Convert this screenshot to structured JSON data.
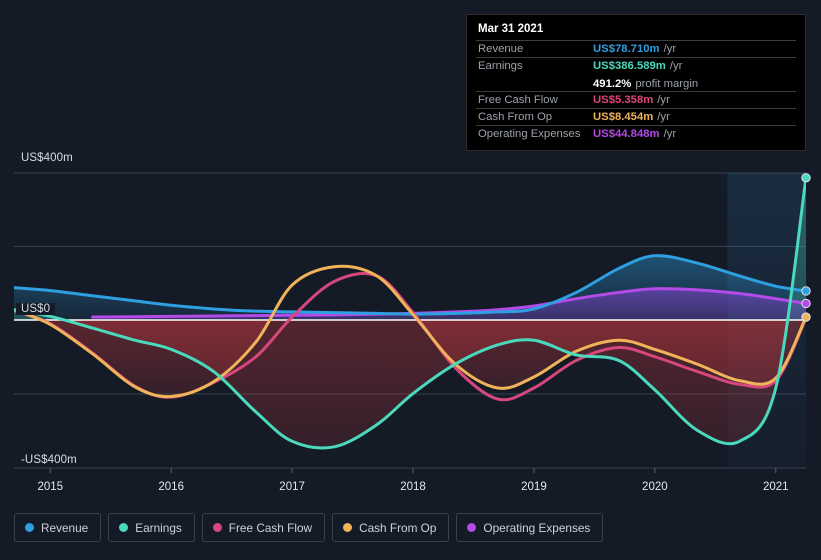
{
  "tooltip": {
    "date": "Mar 31 2021",
    "rows": [
      {
        "name": "Revenue",
        "value": "US$78.710m",
        "unit": "/yr",
        "color": "#2e9fe0"
      },
      {
        "name": "Earnings",
        "value": "US$386.589m",
        "unit": "/yr",
        "color": "#4ad9bd"
      },
      {
        "name": "Free Cash Flow",
        "value": "US$5.358m",
        "unit": "/yr",
        "color": "#e0457e"
      },
      {
        "name": "Cash From Op",
        "value": "US$8.454m",
        "unit": "/yr",
        "color": "#f0b35a"
      },
      {
        "name": "Operating Expenses",
        "value": "US$44.848m",
        "unit": "/yr",
        "color": "#b44ae8"
      }
    ],
    "margin_pct": "491.2%",
    "margin_label": "profit margin"
  },
  "legend": {
    "items": [
      {
        "label": "Revenue",
        "color": "#2e9fe0"
      },
      {
        "label": "Earnings",
        "color": "#4ad9bd"
      },
      {
        "label": "Free Cash Flow",
        "color": "#d6477e"
      },
      {
        "label": "Cash From Op",
        "color": "#f0b35a"
      },
      {
        "label": "Operating Expenses",
        "color": "#b44ae8"
      }
    ]
  },
  "axes": {
    "y_top_label": "US$400m",
    "y_zero_label": "US$0",
    "y_bottom_label": "-US$400m",
    "x_labels": [
      "2015",
      "2016",
      "2017",
      "2018",
      "2019",
      "2020",
      "2021"
    ]
  },
  "chart_data": {
    "type": "line",
    "title": "",
    "xlabel": "",
    "ylabel": "US$",
    "ylim": [
      -400,
      400
    ],
    "grid": true,
    "legend_position": "bottom",
    "x": [
      2014.7,
      2015.0,
      2015.35,
      2015.7,
      2016.0,
      2016.35,
      2016.7,
      2017.0,
      2017.35,
      2017.7,
      2018.0,
      2018.35,
      2018.7,
      2019.0,
      2019.35,
      2019.7,
      2020.0,
      2020.35,
      2020.7,
      2021.0,
      2021.25
    ],
    "x_tick_values": [
      2015,
      2016,
      2017,
      2018,
      2019,
      2020,
      2021
    ],
    "series": [
      {
        "name": "Revenue",
        "color": "#2e9fe0",
        "values": [
          88,
          80,
          66,
          52,
          40,
          30,
          24,
          22,
          20,
          18,
          16,
          18,
          22,
          30,
          75,
          140,
          175,
          155,
          120,
          92,
          79
        ]
      },
      {
        "name": "Earnings",
        "color": "#4ad9bd",
        "values": [
          28,
          10,
          -22,
          -55,
          -80,
          -140,
          -250,
          -330,
          -345,
          -285,
          -200,
          -120,
          -68,
          -55,
          -95,
          -110,
          -190,
          -300,
          -330,
          -185,
          387
        ]
      },
      {
        "name": "Free Cash Flow",
        "color": "#d6477e",
        "values": [
          25,
          -10,
          -90,
          -180,
          -210,
          -170,
          -100,
          8,
          105,
          120,
          20,
          -130,
          -215,
          -185,
          -110,
          -75,
          -100,
          -140,
          -175,
          -165,
          5
        ]
      },
      {
        "name": "Cash From Op",
        "color": "#f0b35a",
        "values": [
          28,
          -12,
          -92,
          -182,
          -208,
          -168,
          -60,
          95,
          145,
          120,
          15,
          -120,
          -185,
          -155,
          -85,
          -55,
          -80,
          -120,
          -165,
          -158,
          8
        ]
      },
      {
        "name": "Operating Expenses",
        "color": "#b44ae8",
        "values": [
          null,
          null,
          8,
          9,
          10,
          11,
          12,
          13,
          14,
          16,
          18,
          22,
          28,
          38,
          58,
          75,
          85,
          82,
          72,
          58,
          45
        ]
      }
    ],
    "final_point_markers": [
      {
        "name": "Earnings",
        "value": 387,
        "color": "#4ad9bd"
      },
      {
        "name": "Revenue",
        "value": 79,
        "color": "#2e9fe0"
      },
      {
        "name": "Operating Expenses",
        "value": 45,
        "color": "#b44ae8"
      },
      {
        "name": "Cash From Op",
        "value": 8,
        "color": "#f0b35a"
      }
    ],
    "highlight_band": {
      "from_x": 2020.6,
      "to_x": 2021.25
    }
  }
}
